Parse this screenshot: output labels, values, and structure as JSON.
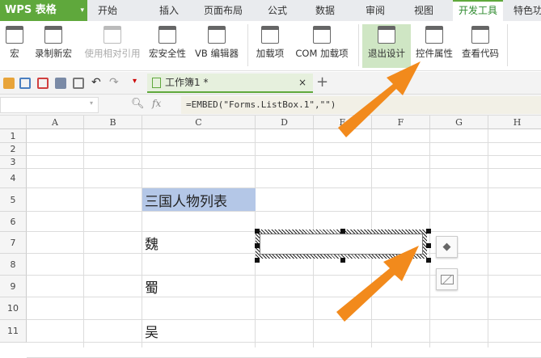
{
  "app": {
    "logo": "WPS 表格"
  },
  "menu_tabs": [
    "开始",
    "插入",
    "页面布局",
    "公式",
    "数据",
    "审阅",
    "视图",
    "开发工具",
    "特色功"
  ],
  "active_tab": "开发工具",
  "ribbon": [
    "宏",
    "录制新宏",
    "使用相对引用",
    "宏安全性",
    "VB 编辑器",
    "加载项",
    "COM 加载项",
    "退出设计",
    "控件属性",
    "查看代码"
  ],
  "doc_tab": {
    "title": "工作簿1 *",
    "close": "×",
    "new": "+"
  },
  "formula_bar": {
    "fx": "fx",
    "formula": "=EMBED(\"Forms.ListBox.1\",\"\")"
  },
  "columns": [
    "A",
    "B",
    "C",
    "D",
    "E",
    "F",
    "G",
    "H"
  ],
  "rows": [
    "1",
    "2",
    "3",
    "4",
    "5",
    "6",
    "7",
    "8",
    "9",
    "10",
    "11"
  ],
  "cells": {
    "C5": "三国人物列表",
    "C7": "魏",
    "C9": "蜀",
    "C11": "吴"
  },
  "colors": {
    "brand": "#5fa83c",
    "arrow": "#f28a1c",
    "highlight": "#b4c7e7"
  }
}
